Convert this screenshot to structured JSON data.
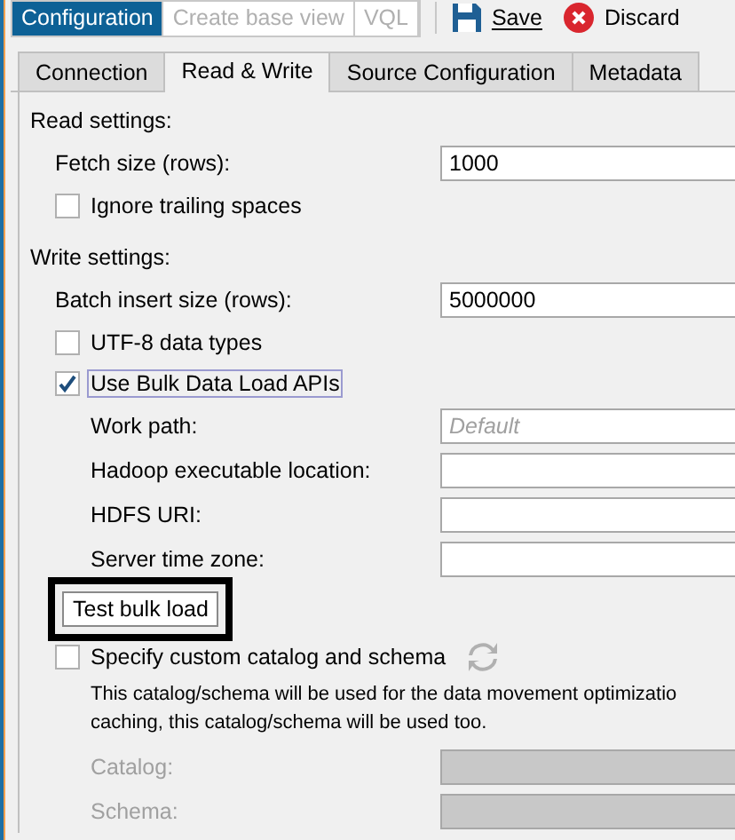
{
  "view_tabs": [
    {
      "label": "Configuration",
      "selected": true
    },
    {
      "label": "Create base view",
      "selected": false
    },
    {
      "label": "VQL",
      "selected": false
    }
  ],
  "toolbar": [
    {
      "kind": "save",
      "label": "Save"
    },
    {
      "kind": "discard",
      "label": "Discard"
    }
  ],
  "tabs": [
    {
      "label": "Connection",
      "selected": false
    },
    {
      "label": "Read & Write",
      "selected": true
    },
    {
      "label": "Source Configuration",
      "selected": false
    },
    {
      "label": "Metadata",
      "selected": false
    }
  ],
  "rows": [
    {
      "kind": "heading",
      "label": "Read settings:"
    },
    {
      "kind": "field",
      "label": "Fetch size (rows):",
      "value": "1000"
    },
    {
      "kind": "checkbox",
      "label": "Ignore trailing spaces",
      "checked": false,
      "focused": false
    },
    {
      "kind": "gap"
    },
    {
      "kind": "heading",
      "label": "Write settings:"
    },
    {
      "kind": "field",
      "label": "Batch insert size (rows):",
      "value": "5000000"
    },
    {
      "kind": "checkbox",
      "label": "UTF-8 data types",
      "checked": false,
      "focused": false
    },
    {
      "kind": "checkbox",
      "label": "Use Bulk Data Load APIs",
      "checked": true,
      "focused": true
    },
    {
      "kind": "subfield",
      "label": "Work path:",
      "placeholder": "Default"
    },
    {
      "kind": "subfield",
      "label": "Hadoop executable location:"
    },
    {
      "kind": "subfield",
      "label": "HDFS URI:"
    },
    {
      "kind": "subfield",
      "label": "Server time zone:"
    },
    {
      "kind": "button",
      "label": "Test bulk load",
      "highlighted": true
    },
    {
      "kind": "checkbox",
      "label": "Specify custom catalog and schema",
      "checked": false,
      "focused": false,
      "refresh": true
    },
    {
      "kind": "paragraph",
      "lines": [
        "This catalog/schema will be used for the data movement optimizatio",
        "caching, this catalog/schema will be used too."
      ]
    },
    {
      "kind": "subfield",
      "label": "Catalog:",
      "disabled": true
    },
    {
      "kind": "subfield",
      "label": "Schema:",
      "disabled": true
    }
  ]
}
